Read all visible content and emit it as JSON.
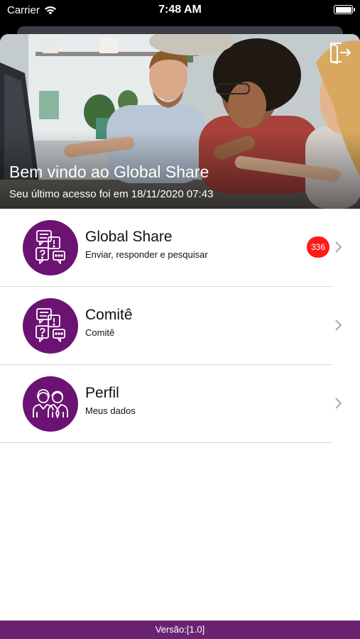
{
  "status_bar": {
    "carrier": "Carrier",
    "time": "7:48 AM",
    "wifi_icon": "wifi-icon",
    "battery_icon": "battery-icon"
  },
  "hero": {
    "title": "Bem vindo ao Global Share",
    "subtitle": "Seu último acesso foi em 18/11/2020 07:43",
    "logout_icon": "logout-icon"
  },
  "menu": {
    "items": [
      {
        "title": "Global Share",
        "subtitle": "Enviar, responder e pesquisar",
        "badge": "336",
        "icon": "chat-bubbles-icon"
      },
      {
        "title": "Comitê",
        "subtitle": "Comitê",
        "icon": "chat-bubbles-icon"
      },
      {
        "title": "Perfil",
        "subtitle": "Meus dados",
        "icon": "people-icon"
      }
    ]
  },
  "footer": {
    "version": "Versão:[1.0]"
  },
  "colors": {
    "brand_purple": "#6b1372",
    "footer_purple": "#6a2373",
    "badge_red": "#ff1a1a"
  }
}
